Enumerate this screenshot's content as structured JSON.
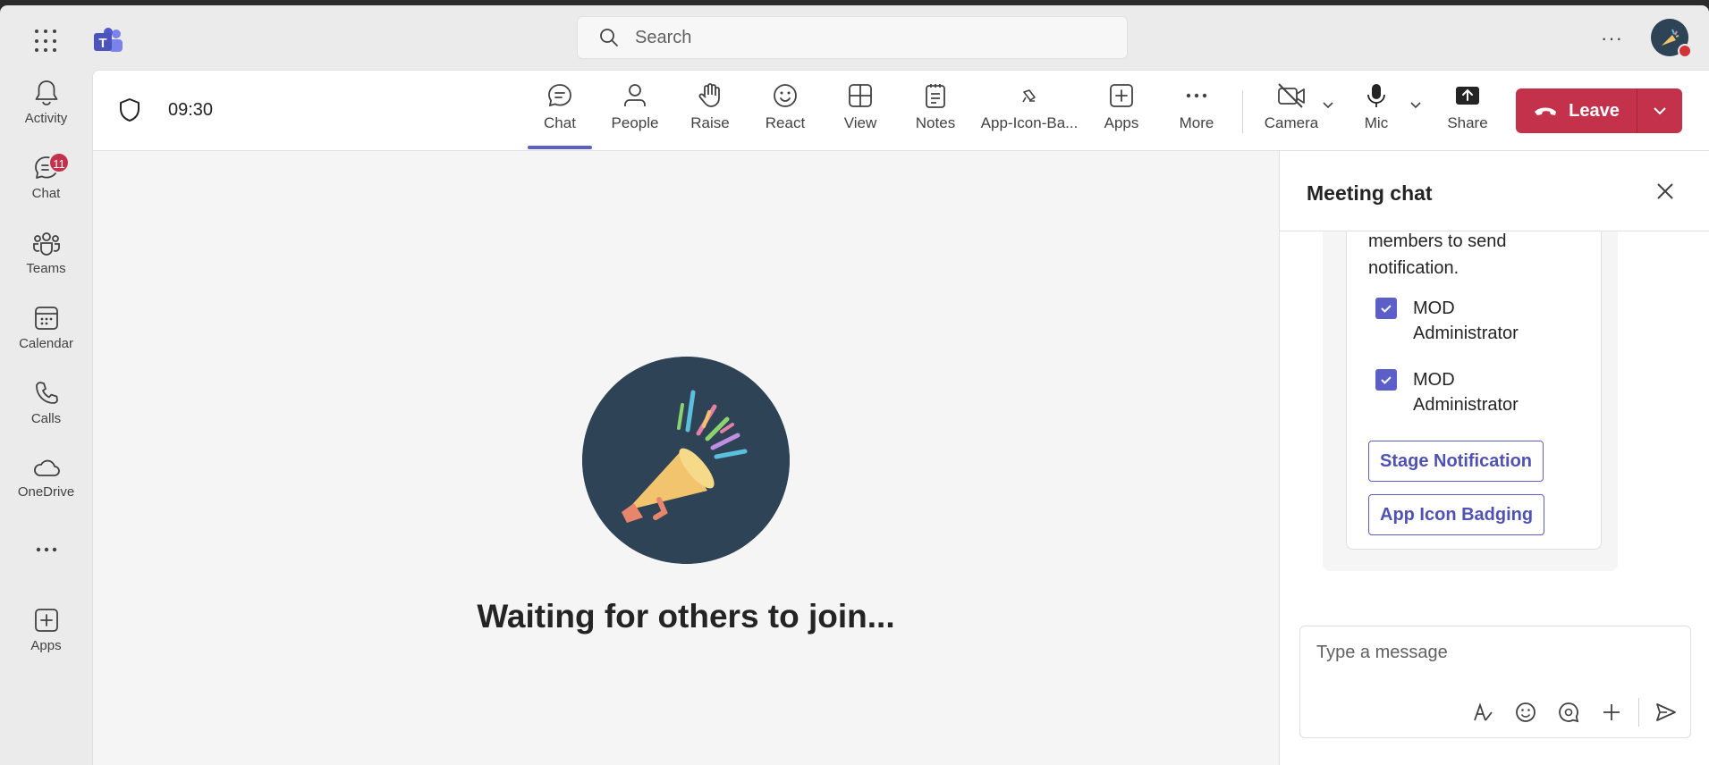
{
  "search": {
    "placeholder": "Search"
  },
  "rail": {
    "items": [
      {
        "label": "Activity",
        "icon": "bell-icon"
      },
      {
        "label": "Chat",
        "icon": "chat-icon",
        "badge": "11"
      },
      {
        "label": "Teams",
        "icon": "teams-icon"
      },
      {
        "label": "Calendar",
        "icon": "calendar-icon"
      },
      {
        "label": "Calls",
        "icon": "phone-icon"
      },
      {
        "label": "OneDrive",
        "icon": "cloud-icon"
      },
      {
        "label": "Apps",
        "icon": "add-app-icon"
      }
    ]
  },
  "meeting": {
    "time": "09:30",
    "toolbar": {
      "chat": "Chat",
      "people": "People",
      "raise": "Raise",
      "react": "React",
      "view": "View",
      "notes": "Notes",
      "app_badging": "App-Icon-Ba...",
      "apps": "Apps",
      "more": "More",
      "camera": "Camera",
      "mic": "Mic",
      "share": "Share",
      "leave": "Leave"
    },
    "waiting_text": "Waiting for others to join..."
  },
  "chat_panel": {
    "title": "Meeting chat",
    "card": {
      "text": "members to send notification.",
      "members": [
        "MOD Administrator",
        "MOD Administrator"
      ],
      "buttons": {
        "stage_notification": "Stage Notification",
        "app_icon_badging": "App Icon Badging"
      }
    },
    "compose": {
      "placeholder": "Type a message"
    }
  },
  "colors": {
    "accent": "#5b5fc7",
    "leave_red": "#c4314b",
    "badge_red": "#c4314b",
    "stage_circle": "#2f4356"
  }
}
